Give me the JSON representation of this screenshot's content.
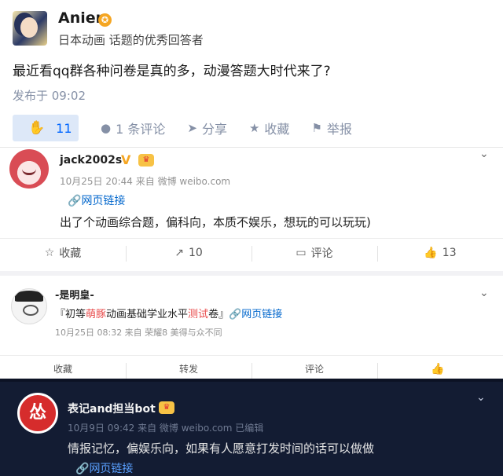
{
  "zhihu": {
    "author": "Anier",
    "badge": "✪",
    "author_desc": "日本动画 话题的优秀回答者",
    "question": "最近看qq群各种问卷是真的多，动漫答题大时代来了?",
    "time": "发布于 09:02",
    "actions": {
      "like_count": "11",
      "comments": "1 条评论",
      "share": "分享",
      "favorite": "收藏",
      "report": "举报"
    },
    "accent": "#0066ff"
  },
  "weibo1": {
    "name": "jack2002s",
    "verified": "V",
    "meta": "10月25日 20:44 来自 微博 weibo.com",
    "link": "网页链接",
    "text": "出了个动画综合题，偏科向，本质不娱乐，想玩的可以玩玩)",
    "actions": {
      "favorite": "收藏",
      "repost": "10",
      "comment": "评论",
      "like": "13"
    }
  },
  "weibo2": {
    "name": "-是明皇-",
    "text_parts": {
      "a": "『初等",
      "b": "萌豚",
      "c": "动画基础学业水平",
      "d": "测试",
      "e": "卷』",
      "link": "网页链接"
    },
    "meta": "10月25日 08:32 来自 荣耀8 美得与众不同",
    "actions": {
      "favorite": "收藏",
      "repost": "转发",
      "comment": "评论"
    }
  },
  "weibo3": {
    "name": "表记and担当bot",
    "avatar_glyph": "怂",
    "meta": "10月9日 09:42 来自 微博 weibo.com   已编辑",
    "text": "情报记忆，偏娱乐向，如果有人愿意打发时间的话可以做做",
    "link": "网页链接",
    "bg": "#131c33"
  }
}
